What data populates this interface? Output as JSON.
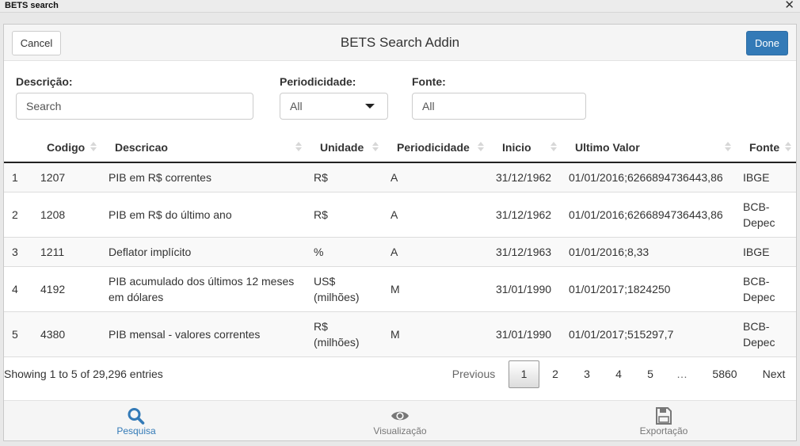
{
  "window": {
    "title": "BETS search",
    "close": "✕"
  },
  "header": {
    "cancel_label": "Cancel",
    "title": "BETS Search Addin",
    "done_label": "Done"
  },
  "filters": {
    "descricao": {
      "label": "Descrição:",
      "placeholder": "Search"
    },
    "periodicidade": {
      "label": "Periodicidade:",
      "value": "All"
    },
    "fonte": {
      "label": "Fonte:",
      "placeholder": "All"
    }
  },
  "table": {
    "columns": [
      "Codigo",
      "Descricao",
      "Unidade",
      "Periodicidade",
      "Inicio",
      "Ultimo Valor",
      "Fonte"
    ],
    "rows": [
      {
        "index": "1",
        "codigo": "1207",
        "descricao": "PIB em R$ correntes",
        "unidade": "R$",
        "periodicidade": "A",
        "inicio": "31/12/1962",
        "ultimo_valor": "01/01/2016;6266894736443,86",
        "fonte": "IBGE"
      },
      {
        "index": "2",
        "codigo": "1208",
        "descricao": "PIB em R$ do último ano",
        "unidade": "R$",
        "periodicidade": "A",
        "inicio": "31/12/1962",
        "ultimo_valor": "01/01/2016;6266894736443,86",
        "fonte_1": "BCB-",
        "fonte_2": "Depec"
      },
      {
        "index": "3",
        "codigo": "1211",
        "descricao": "Deflator implícito",
        "unidade": "%",
        "periodicidade": "A",
        "inicio": "31/12/1963",
        "ultimo_valor": "01/01/2016;8,33",
        "fonte": "IBGE"
      },
      {
        "index": "4",
        "codigo": "4192",
        "descricao_1": "PIB acumulado dos últimos 12 meses",
        "descricao_2": "em dólares",
        "unidade_1": "US$",
        "unidade_2": "(milhões)",
        "periodicidade": "M",
        "inicio": "31/01/1990",
        "ultimo_valor": "01/01/2017;1824250",
        "fonte_1": "BCB-",
        "fonte_2": "Depec"
      },
      {
        "index": "5",
        "codigo": "4380",
        "descricao": "PIB mensal - valores correntes",
        "unidade_1": "R$",
        "unidade_2": "(milhões)",
        "periodicidade": "M",
        "inicio": "31/01/1990",
        "ultimo_valor": "01/01/2017;515297,7",
        "fonte_1": "BCB-",
        "fonte_2": "Depec"
      }
    ]
  },
  "info": "Showing 1 to 5 of 29,296 entries",
  "pagination": {
    "previous": "Previous",
    "pages": [
      "1",
      "2",
      "3",
      "4",
      "5"
    ],
    "ellipsis": "…",
    "last": "5860",
    "next": "Next",
    "active": "1"
  },
  "tabs": [
    {
      "label": "Pesquisa",
      "icon": "search-icon",
      "active": true
    },
    {
      "label": "Visualização",
      "icon": "eye-icon",
      "active": false
    },
    {
      "label": "Exportação",
      "icon": "floppy-disk-icon",
      "active": false
    }
  ],
  "colors": {
    "primary": "#337ab7",
    "header_bg": "#f5f5f5"
  }
}
